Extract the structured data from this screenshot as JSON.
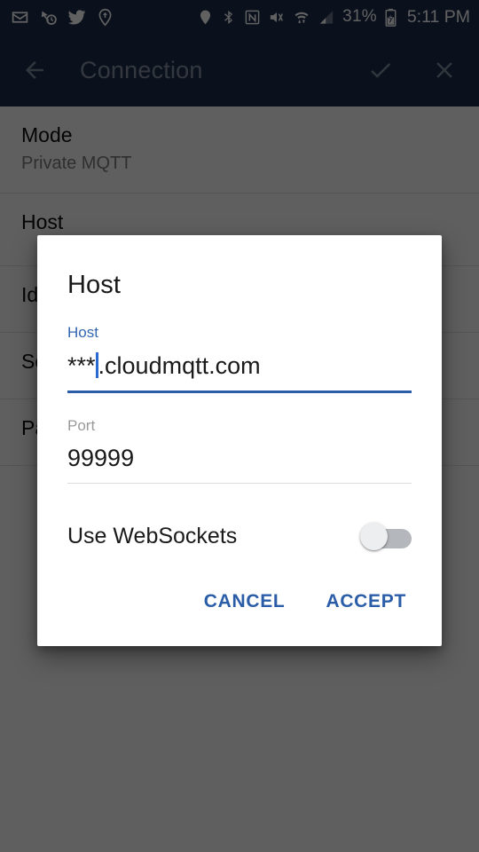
{
  "statusbar": {
    "left_icons": [
      "gmail-icon",
      "sync-history-icon",
      "twitter-icon",
      "location-share-icon"
    ],
    "right_icons": [
      "location-icon",
      "bluetooth-icon",
      "nfc-icon",
      "volume-mute-icon",
      "wifi-transfer-icon",
      "cellular-signal-icon"
    ],
    "battery_percent": "31%",
    "battery_icon": "battery-charging-icon",
    "time": "5:11 PM"
  },
  "appbar": {
    "back_icon": "back-arrow-icon",
    "title": "Connection",
    "confirm_icon": "check-icon",
    "close_icon": "close-icon"
  },
  "background_list": [
    {
      "title": "Mode",
      "subtitle": "Private MQTT"
    },
    {
      "title": "Host",
      "subtitle": ""
    },
    {
      "title": "Identity",
      "subtitle": ""
    },
    {
      "title": "Security",
      "subtitle": ""
    },
    {
      "title": "Password",
      "subtitle": ""
    }
  ],
  "dialog": {
    "title": "Host",
    "host_field": {
      "label": "Host",
      "value_before_caret": "***",
      "value_after_caret": ".cloudmqtt.com",
      "full_value": "***.cloudmqtt.com"
    },
    "port_field": {
      "label": "Port",
      "value": "99999"
    },
    "websockets": {
      "label": "Use WebSockets",
      "state": "off"
    },
    "cancel_label": "CANCEL",
    "accept_label": "ACCEPT"
  },
  "colors": {
    "appbar": "#1b2d4e",
    "accent_blue": "#2a5ca8",
    "caret_blue": "#2a6ad0",
    "scrim": "rgba(0,0,0,0.62)"
  }
}
